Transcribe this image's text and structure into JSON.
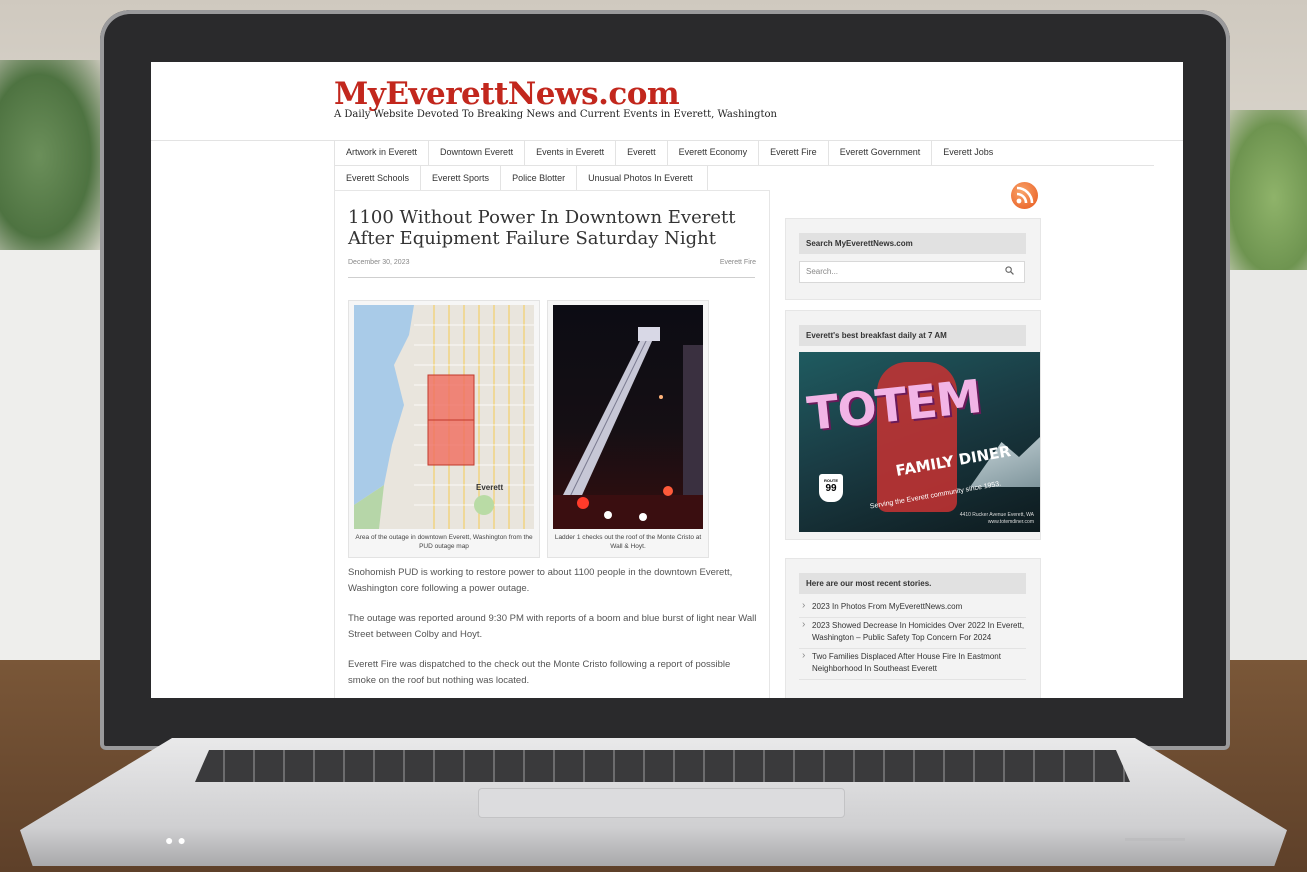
{
  "site": {
    "title": "MyEverettNews.com",
    "tagline": "A Daily Website Devoted To Breaking News and Current Events in Everett, Washington"
  },
  "nav": {
    "row1": [
      "Artwork in Everett",
      "Downtown Everett",
      "Events in Everett",
      "Everett",
      "Everett Economy",
      "Everett Fire",
      "Everett Government",
      "Everett Jobs"
    ],
    "row2": [
      "Everett Schools",
      "Everett Sports",
      "Police Blotter",
      "Unusual Photos In Everett"
    ]
  },
  "article": {
    "title": "1100 Without Power In Downtown Everett After Equipment Failure Saturday Night",
    "date": "December 30, 2023",
    "category": "Everett Fire",
    "figures": [
      {
        "caption": "Area of the outage in downtown Everett, Washington from the PUD outage map",
        "map_label": "Everett"
      },
      {
        "caption": "Ladder 1 checks out the roof of the Monte Cristo at Wall & Hoyt."
      }
    ],
    "paragraphs": [
      "Snohomish PUD is working to restore power to about 1100 people in the downtown Everett, Washington core following a power outage.",
      "The outage was reported around 9:30 PM with reports of a boom and blue burst of light near Wall Street between Colby and Hoyt.",
      "Everett Fire was dispatched to the check out the Monte Cristo following a report of possible smoke on the roof but nothing was located."
    ]
  },
  "sidebar": {
    "search": {
      "title": "Search MyEverettNews.com",
      "placeholder": "Search..."
    },
    "ad": {
      "title": "Everett's best breakfast daily at 7 AM",
      "brand": "TOTEM",
      "subbrand": "FAMILY DINER",
      "slogan": "Serving the Everett community since 1953.",
      "address": "4410 Rucker Avenue Everett, WA",
      "website": "www.totemdiner.com",
      "route_label": "ROUTE",
      "route_number": "99"
    },
    "recent": {
      "title": "Here are our most recent stories.",
      "items": [
        "2023 In Photos From MyEverettNews.com",
        "2023 Showed Decrease In Homicides Over 2022 In Everett, Washington – Public Safety Top Concern For 2024",
        "Two Families Displaced After House Fire In Eastmont Neighborhood In Southeast Everett"
      ]
    }
  },
  "colors": {
    "brand": "#c2271d",
    "rss": "#e7571c"
  }
}
